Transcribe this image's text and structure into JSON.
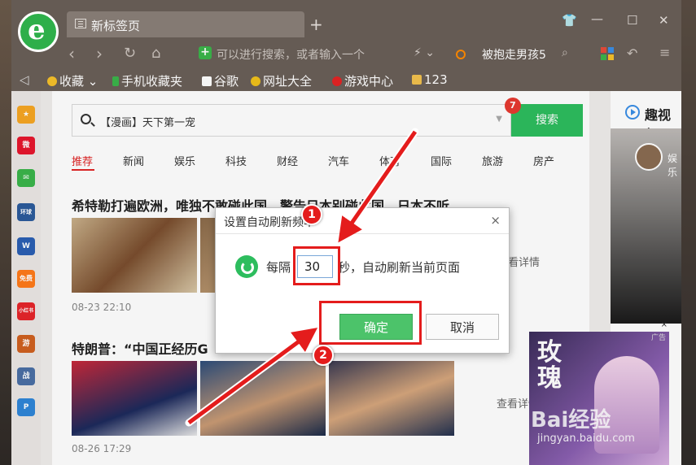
{
  "browser": {
    "tab_title": "新标签页",
    "address_placeholder": "可以进行搜索，或者输入一个",
    "hot_search": "被抱走男孩5"
  },
  "bookmarks": [
    {
      "label": "收藏",
      "color": "#f6c12a"
    },
    {
      "label": "手机收藏夹",
      "color": "#3bb54a"
    },
    {
      "label": "谷歌",
      "color": "#ffffff"
    },
    {
      "label": "网址大全",
      "color": "#f0c11b"
    },
    {
      "label": "游戏中心",
      "color": "#e32424"
    },
    {
      "label": "123",
      "color": "#f2c14e"
    }
  ],
  "sidebar_icons": [
    {
      "name": "star-icon",
      "color": "#f6a623",
      "text": "★"
    },
    {
      "name": "weibo-icon",
      "color": "#e6162d",
      "text": "微"
    },
    {
      "name": "mail-icon",
      "color": "#3bb54a",
      "text": "✉"
    },
    {
      "name": "news-icon",
      "color": "#2c5b9c",
      "text": "环球"
    },
    {
      "name": "word-icon",
      "color": "#2b5fb4",
      "text": "W"
    },
    {
      "name": "novel-icon",
      "color": "#ff7a1a",
      "text": "免费"
    },
    {
      "name": "redbook-icon",
      "color": "#e5252a",
      "text": "小红书"
    },
    {
      "name": "game-icon",
      "color": "#d06020",
      "text": "游"
    },
    {
      "name": "game2-icon",
      "color": "#4a6fa5",
      "text": "战"
    },
    {
      "name": "ppt-icon",
      "color": "#2f86d8",
      "text": "P"
    }
  ],
  "search": {
    "query": "【漫画】天下第一宠",
    "button": "搜索",
    "badge": "7"
  },
  "categories": [
    "推荐",
    "新闻",
    "娱乐",
    "科技",
    "财经",
    "汽车",
    "体育",
    "国际",
    "旅游",
    "房产"
  ],
  "news": [
    {
      "title": "希特勒打遍欧洲，唯独不敢碰此国，警告日本别碰此国，日本不听",
      "time": "08-23 22:10",
      "more": "看详情"
    },
    {
      "title": "特朗普：“中国正经历G",
      "time": "08-26 17:29",
      "more": "查看详情"
    }
  ],
  "right_panel": {
    "title": "趣视频",
    "user": "娱乐"
  },
  "ad": {
    "title": "玫瑰",
    "tag": "广告",
    "close": "×"
  },
  "watermark": {
    "brand": "Bai经验",
    "url": "jingyan.baidu.com"
  },
  "dialog": {
    "title": "设置自动刷新频率",
    "prefix": "每隔",
    "value": "30",
    "suffix": "秒，自动刷新当前页面",
    "ok": "确定",
    "cancel": "取消",
    "close": "×"
  },
  "annotations": {
    "step1": "1",
    "step2": "2",
    "color": "#e41c1c"
  }
}
